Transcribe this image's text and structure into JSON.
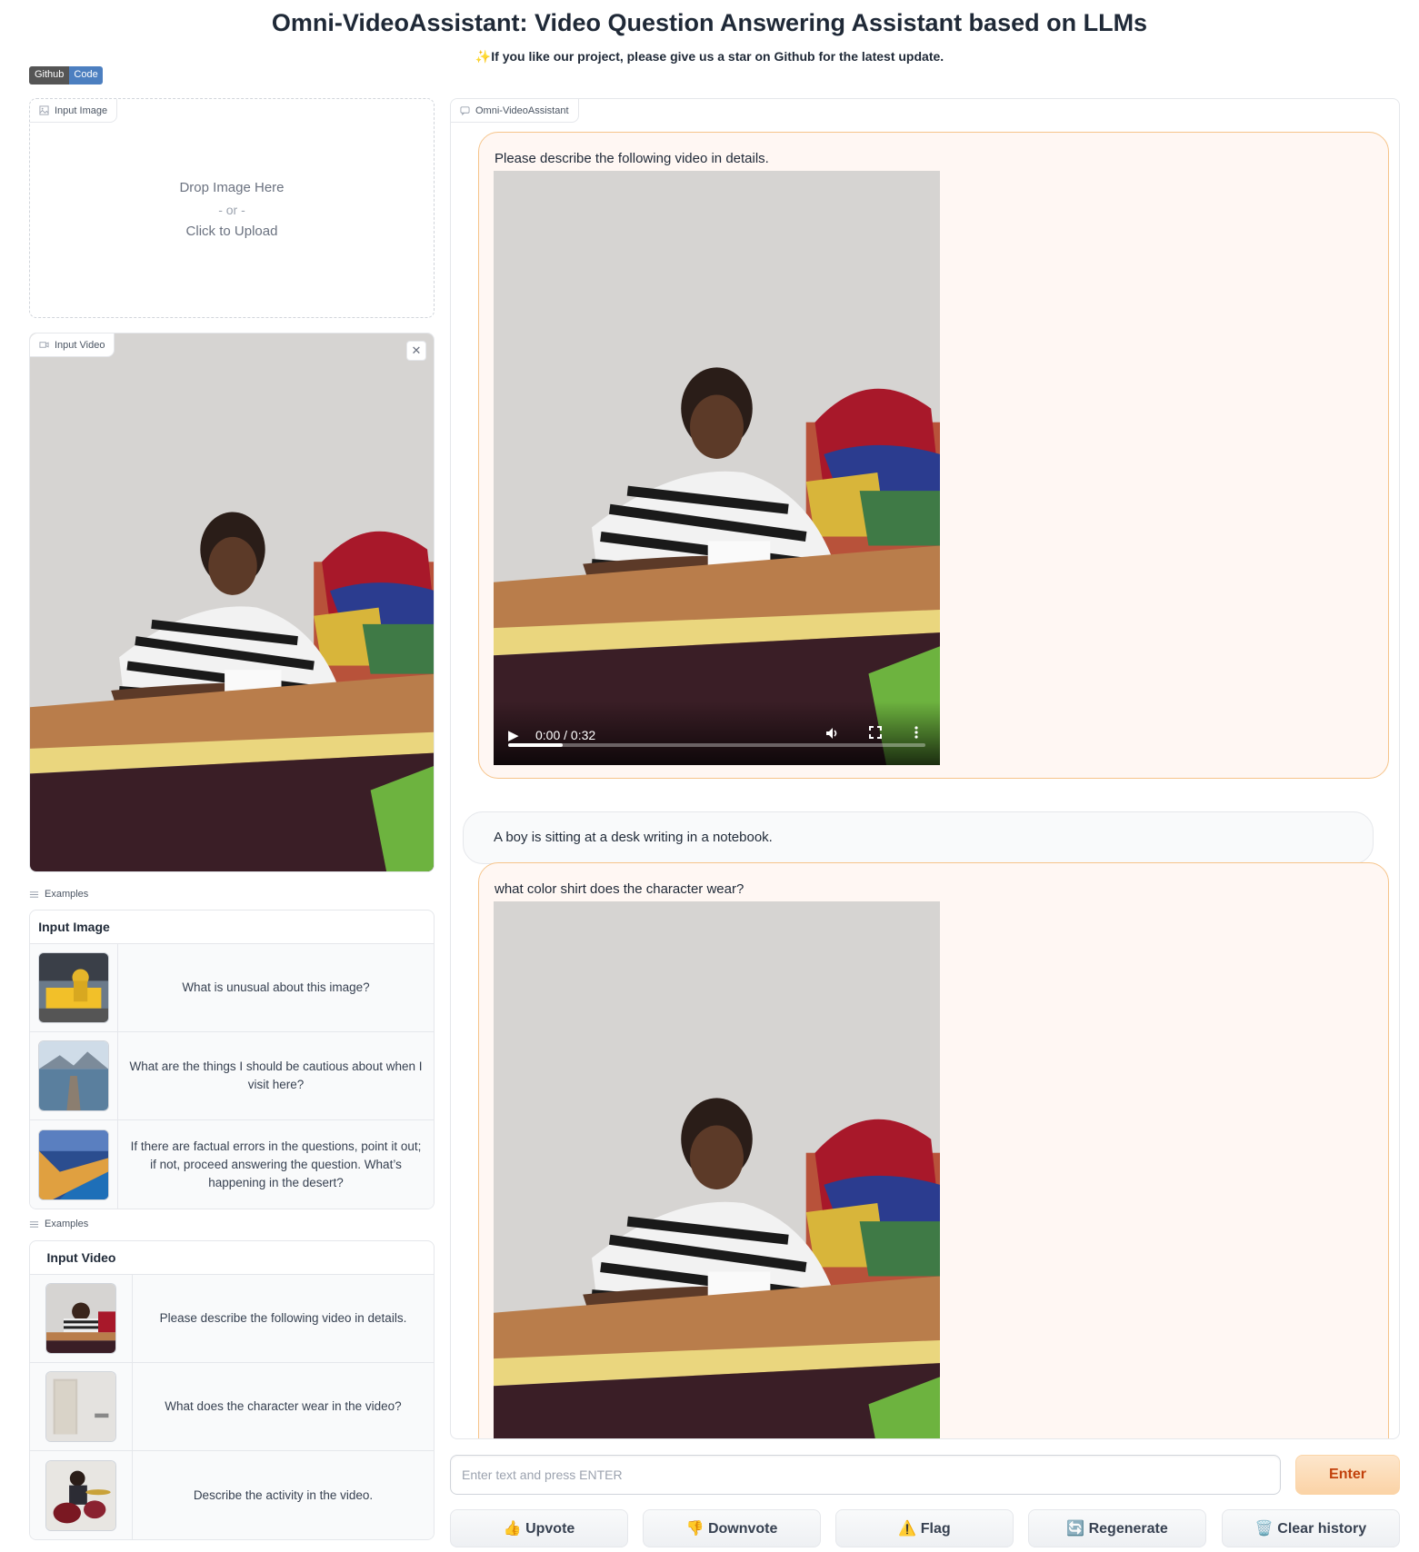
{
  "header": {
    "title": "Omni-VideoAssistant: Video Question Answering Assistant based on LLMs",
    "subtitle": "✨If you like our project, please give us a star on Github for the latest update.",
    "badge_left": "Github",
    "badge_right": "Code"
  },
  "image_input": {
    "label": "Input Image",
    "drop_text": "Drop Image Here",
    "or_text": "- or -",
    "click_text": "Click to Upload"
  },
  "video_input": {
    "label": "Input Video",
    "close_symbol": "✕"
  },
  "image_examples": {
    "label": "Examples",
    "header": "Input Image",
    "rows": [
      {
        "text": "What is unusual about this image?",
        "thumb": "taxi-ironing"
      },
      {
        "text": "What are the things I should be cautious about when I visit here?",
        "thumb": "lake-dock"
      },
      {
        "text": "If there are factual errors in the questions, point it out; if not, proceed answering the question. What’s happening in the desert?",
        "thumb": "city-coast"
      }
    ]
  },
  "video_examples": {
    "label": "Examples",
    "header": "Input Video",
    "rows": [
      {
        "text": "Please describe the following video in details.",
        "thumb": "boy-writing"
      },
      {
        "text": "What does the character wear in the video?",
        "thumb": "room-door"
      },
      {
        "text": "Describe the activity in the video.",
        "thumb": "drummer"
      }
    ]
  },
  "chat": {
    "label": "Omni-VideoAssistant",
    "messages": [
      {
        "role": "user",
        "text": "Please describe the following video in details."
      },
      {
        "role": "bot",
        "text": "A boy is sitting at a desk writing in a notebook."
      },
      {
        "role": "user",
        "text": "what color shirt does the character wear?"
      }
    ],
    "player": {
      "time": "0:00 / 0:32",
      "progress": 0.13
    }
  },
  "input": {
    "placeholder": "Enter text and press ENTER",
    "enter_label": "Enter"
  },
  "actions": {
    "upvote": "👍  Upvote",
    "downvote": "👎  Downvote",
    "flag": "⚠️  Flag",
    "regenerate": "🔄  Regenerate",
    "clear": "🗑️  Clear history"
  },
  "colors": {
    "user_bubble_bg": "#fff7f3",
    "user_bubble_border": "#f6c48a",
    "enter_button_text": "#c2410c"
  }
}
